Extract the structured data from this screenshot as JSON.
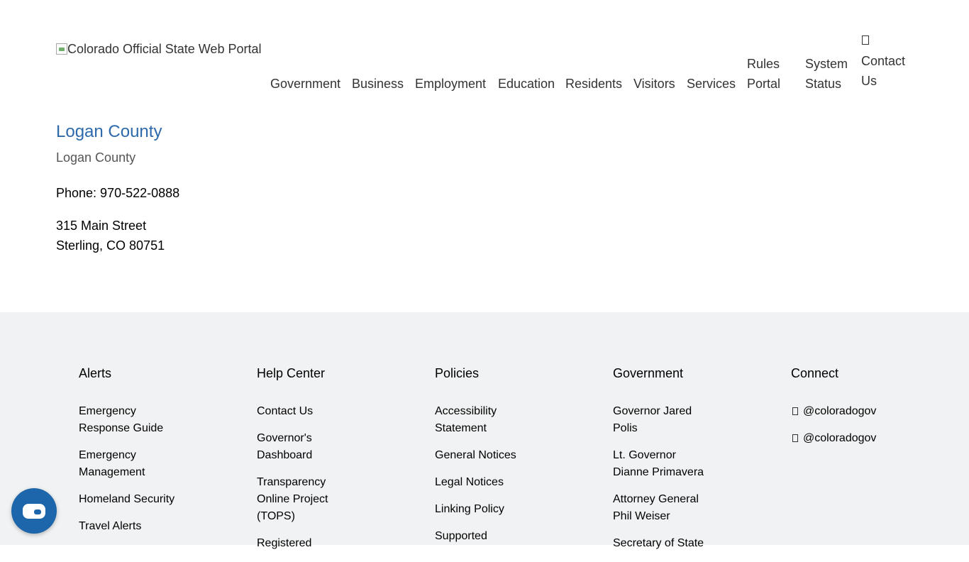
{
  "header": {
    "logo_alt": "Colorado Official State Web Portal",
    "nav": [
      {
        "lines": [
          "Government"
        ]
      },
      {
        "lines": [
          "Business"
        ]
      },
      {
        "lines": [
          "Employment"
        ]
      },
      {
        "lines": [
          "Education"
        ]
      },
      {
        "lines": [
          "Residents"
        ]
      },
      {
        "lines": [
          "Visitors"
        ]
      },
      {
        "lines": [
          "Services"
        ]
      },
      {
        "lines": [
          "Rules",
          "Portal"
        ]
      },
      {
        "lines": [
          "System",
          "Status"
        ]
      },
      {
        "lines": [
          "Contact",
          "Us"
        ],
        "icon": "envelope-icon"
      }
    ]
  },
  "main": {
    "title": "Logan County",
    "subtitle": "Logan County",
    "phone": "Phone: 970-522-0888",
    "address_line1": "315 Main Street",
    "address_line2": "Sterling, CO 80751"
  },
  "footer": {
    "columns": [
      {
        "heading": "Alerts",
        "items": [
          [
            "Emergency",
            "Response Guide"
          ],
          [
            "Emergency",
            "Management"
          ],
          [
            "Homeland Security"
          ],
          [
            "Travel Alerts"
          ]
        ]
      },
      {
        "heading": "Help Center",
        "items": [
          [
            "Contact Us"
          ],
          [
            "Governor's",
            "Dashboard"
          ],
          [
            "Transparency",
            "Online Project",
            "(TOPS)"
          ],
          [
            "Registered"
          ]
        ]
      },
      {
        "heading": "Policies",
        "items": [
          [
            "Accessibility",
            "Statement"
          ],
          [
            "General Notices"
          ],
          [
            "Legal Notices"
          ],
          [
            "Linking Policy"
          ],
          [
            "Supported"
          ]
        ]
      },
      {
        "heading": "Government",
        "items": [
          [
            "Governor Jared",
            "Polis"
          ],
          [
            "Lt. Governor",
            "Dianne Primavera"
          ],
          [
            "Attorney General",
            "Phil Weiser"
          ],
          [
            "Secretary of State"
          ]
        ]
      },
      {
        "heading": "Connect",
        "items": [
          [
            "@coloradogov"
          ],
          [
            "@coloradogov"
          ]
        ],
        "icons": [
          "facebook-icon",
          "twitter-icon"
        ]
      }
    ]
  },
  "chat": {
    "icon": "chat-bubble-icon"
  },
  "colors": {
    "link_blue": "#2e6aab",
    "footer_bg": "#f1f2f3",
    "chat_button": "#1d66ab"
  }
}
